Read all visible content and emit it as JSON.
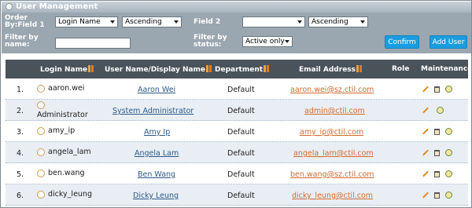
{
  "window": {
    "title": "User Management"
  },
  "filters": {
    "order_by_label": "Order By:Field 1",
    "order_field1": "Login Name",
    "order_dir1": "Ascending",
    "field2_label": "Field 2",
    "order_field2": "",
    "order_dir2": "Ascending",
    "filter_name_label": "Filter by name:",
    "filter_name_value": "",
    "filter_status_label": "Filter by status:",
    "filter_status_value": "Active only",
    "confirm_label": "Confirm",
    "add_user_label": "Add User"
  },
  "table": {
    "headers": {
      "login_name": "Login Name",
      "user_name": "User Name/Display Name",
      "department": "Department",
      "email": "Email Address",
      "role": "Role",
      "maintenance": "Maintenance"
    },
    "rows": [
      {
        "num": "1.",
        "login": "aaron.wei",
        "display": "Aaron Wei",
        "dept": "Default",
        "email": "aaron.wei@sz.ctil.com"
      },
      {
        "num": "2.",
        "login": "Administrator",
        "display": "System Administrator",
        "dept": "Default",
        "email": "admin@ctil.com"
      },
      {
        "num": "3.",
        "login": "amy_ip",
        "display": "Amy Ip",
        "dept": "Default",
        "email": "amy_ip@ctil.com"
      },
      {
        "num": "4.",
        "login": "angela_lam",
        "display": "Angela Lam",
        "dept": "Default",
        "email": "angela_lam@ctil.com"
      },
      {
        "num": "5.",
        "login": "ben.wang",
        "display": "Ben Wang",
        "dept": "Default",
        "email": "ben.wang@sz.ctil.com"
      },
      {
        "num": "6.",
        "login": "dicky_leung",
        "display": "Dicky Leung",
        "dept": "Default",
        "email": "dicky_leung@ctil.com"
      }
    ]
  }
}
